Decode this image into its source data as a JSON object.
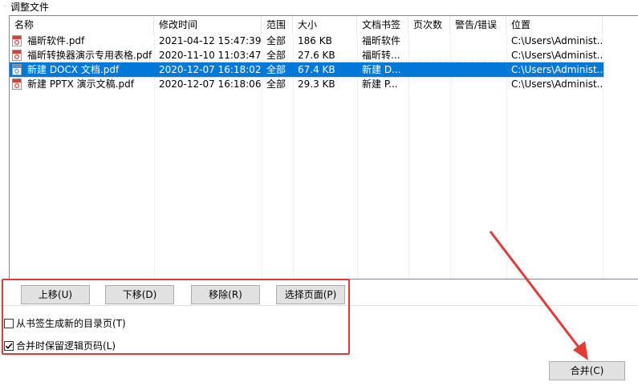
{
  "group_title": "调整文件",
  "columns": [
    "名称",
    "修改时间",
    "范围",
    "大小",
    "文档书签",
    "页次数",
    "警告/错误",
    "位置"
  ],
  "rows": [
    {
      "name": "福昕软件.pdf",
      "modified": "2021-04-12 15:47:39",
      "range": "全部",
      "size": "186 KB",
      "bookmark": "福昕软件",
      "pages": "",
      "warning": "",
      "location": "C:\\Users\\Administ...",
      "selected": false
    },
    {
      "name": "福昕转换器演示专用表格.pdf",
      "modified": "2020-11-10 11:03:47",
      "range": "全部",
      "size": "27.6 KB",
      "bookmark": "福昕转...",
      "pages": "",
      "warning": "",
      "location": "C:\\Users\\Administ...",
      "selected": false
    },
    {
      "name": "新建 DOCX 文档.pdf",
      "modified": "2020-12-07 16:18:02",
      "range": "全部",
      "size": "67.4 KB",
      "bookmark": "新建 D...",
      "pages": "",
      "warning": "",
      "location": "C:\\Users\\Administ...",
      "selected": true
    },
    {
      "name": "新建 PPTX 演示文稿.pdf",
      "modified": "2020-12-07 16:18:06",
      "range": "全部",
      "size": "29.3 KB",
      "bookmark": "新建 P...",
      "pages": "",
      "warning": "",
      "location": "C:\\Users\\Administ...",
      "selected": false
    }
  ],
  "buttons": {
    "move_up": "上移(U)",
    "move_down": "下移(D)",
    "remove": "移除(R)",
    "select_pages": "选择页面(P)",
    "merge": "合并(C)"
  },
  "checkboxes": {
    "generate_toc": {
      "label": "从书签生成新的目录页(T)",
      "checked": false
    },
    "keep_logical_page": {
      "label": "合并时保留逻辑页码(L)",
      "checked": true
    }
  },
  "colors": {
    "selection": "#0078d7",
    "annotation": "#e53935"
  }
}
